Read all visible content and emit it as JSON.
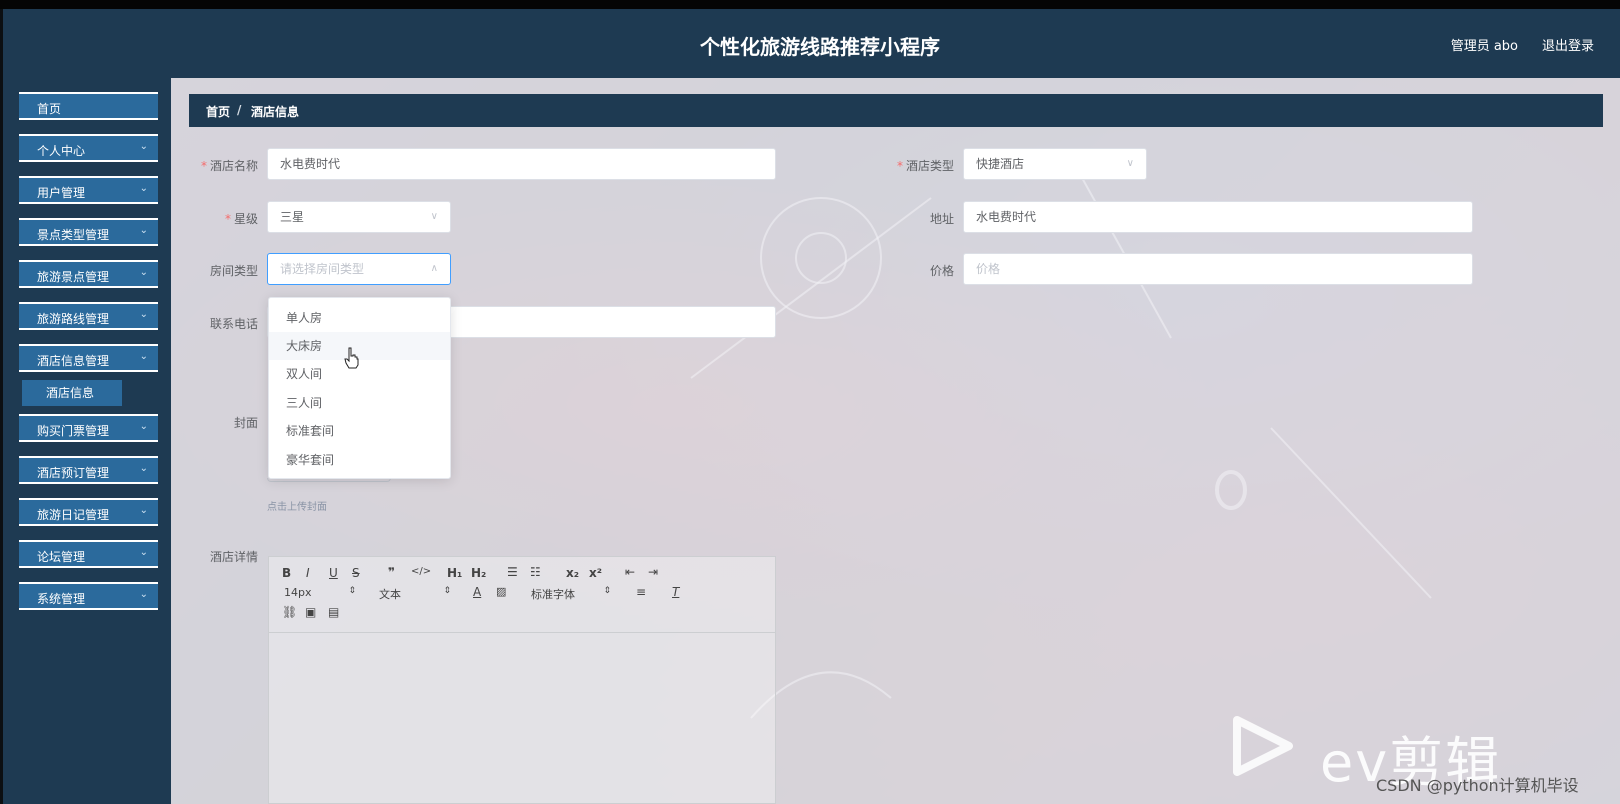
{
  "header": {
    "title": "个性化旅游线路推荐小程序",
    "admin": "管理员 abo",
    "logout": "退出登录"
  },
  "sidebar": {
    "items": [
      {
        "label": "首页",
        "has_chevron": false
      },
      {
        "label": "个人中心",
        "has_chevron": true
      },
      {
        "label": "用户管理",
        "has_chevron": true
      },
      {
        "label": "景点类型管理",
        "has_chevron": true
      },
      {
        "label": "旅游景点管理",
        "has_chevron": true
      },
      {
        "label": "旅游路线管理",
        "has_chevron": true
      },
      {
        "label": "酒店信息管理",
        "has_chevron": true,
        "expanded": true
      },
      {
        "label": "购买门票管理",
        "has_chevron": true
      },
      {
        "label": "酒店预订管理",
        "has_chevron": true
      },
      {
        "label": "旅游日记管理",
        "has_chevron": true
      },
      {
        "label": "论坛管理",
        "has_chevron": true
      },
      {
        "label": "系统管理",
        "has_chevron": true
      }
    ],
    "sub_item": "酒店信息"
  },
  "breadcrumb": {
    "home": "首页",
    "sep": "/",
    "current": "酒店信息"
  },
  "form": {
    "hotel_name": {
      "label": "酒店名称",
      "value": "水电费时代",
      "required": true
    },
    "hotel_type": {
      "label": "酒店类型",
      "value": "快捷酒店",
      "required": true
    },
    "star": {
      "label": "星级",
      "value": "三星",
      "required": true
    },
    "address": {
      "label": "地址",
      "value": "水电费时代"
    },
    "room_type": {
      "label": "房间类型",
      "placeholder": "请选择房间类型"
    },
    "price": {
      "label": "价格",
      "placeholder": "价格"
    },
    "phone": {
      "label": "联系电话",
      "value": ""
    },
    "cover": {
      "label": "封面",
      "hint": "点击上传封面"
    },
    "details": {
      "label": "酒店详情"
    }
  },
  "room_options": [
    "单人房",
    "大床房",
    "双人间",
    "三人间",
    "标准套间",
    "豪华套间"
  ],
  "hovered_option": "大床房",
  "editor_toolbar": {
    "font_size": "14px",
    "text_type": "文本",
    "font_family": "标准字体"
  },
  "watermark": {
    "app": "ev剪辑",
    "credit": "CSDN @python计算机毕设"
  },
  "colors": {
    "navy": "#1e3a52",
    "item_blue": "#2b6a9c",
    "required": "#f56c6c"
  }
}
